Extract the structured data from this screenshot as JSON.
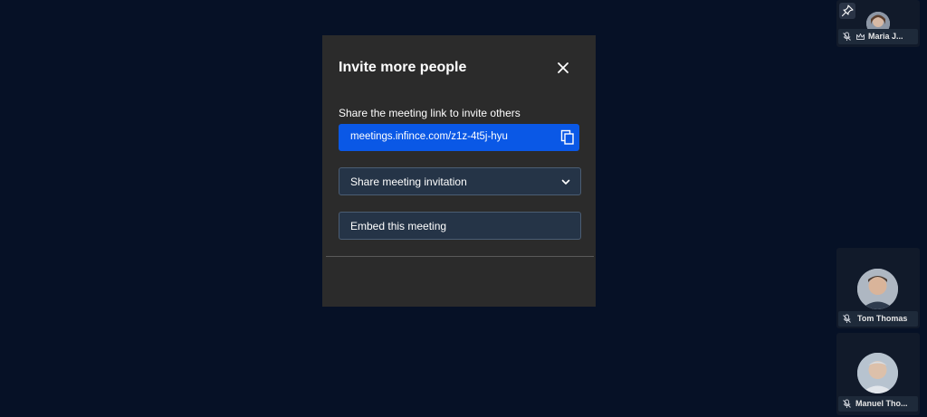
{
  "modal": {
    "title": "Invite more people",
    "share_label": "Share the meeting link to invite others",
    "link": "meetings.infince.com/z1z-4t5j-hyu",
    "share_invitation": "Share meeting invitation",
    "embed": "Embed this meeting"
  },
  "participants": [
    {
      "name": "Maria J...",
      "muted": true,
      "moderator": true,
      "pinned_button": true
    },
    {
      "name": "Tom Thomas",
      "muted": true
    },
    {
      "name": "Manuel Tho...",
      "muted": true
    }
  ],
  "icons": {
    "close": "close-icon",
    "copy": "copy-icon",
    "chevron": "chevron-down-icon",
    "pin": "pin-icon",
    "mic_off": "mic-off-icon",
    "crown": "crown-icon"
  },
  "colors": {
    "background": "#061126",
    "modal": "#2b2b2b",
    "link_box": "#0a58e6",
    "field": "#253447"
  }
}
